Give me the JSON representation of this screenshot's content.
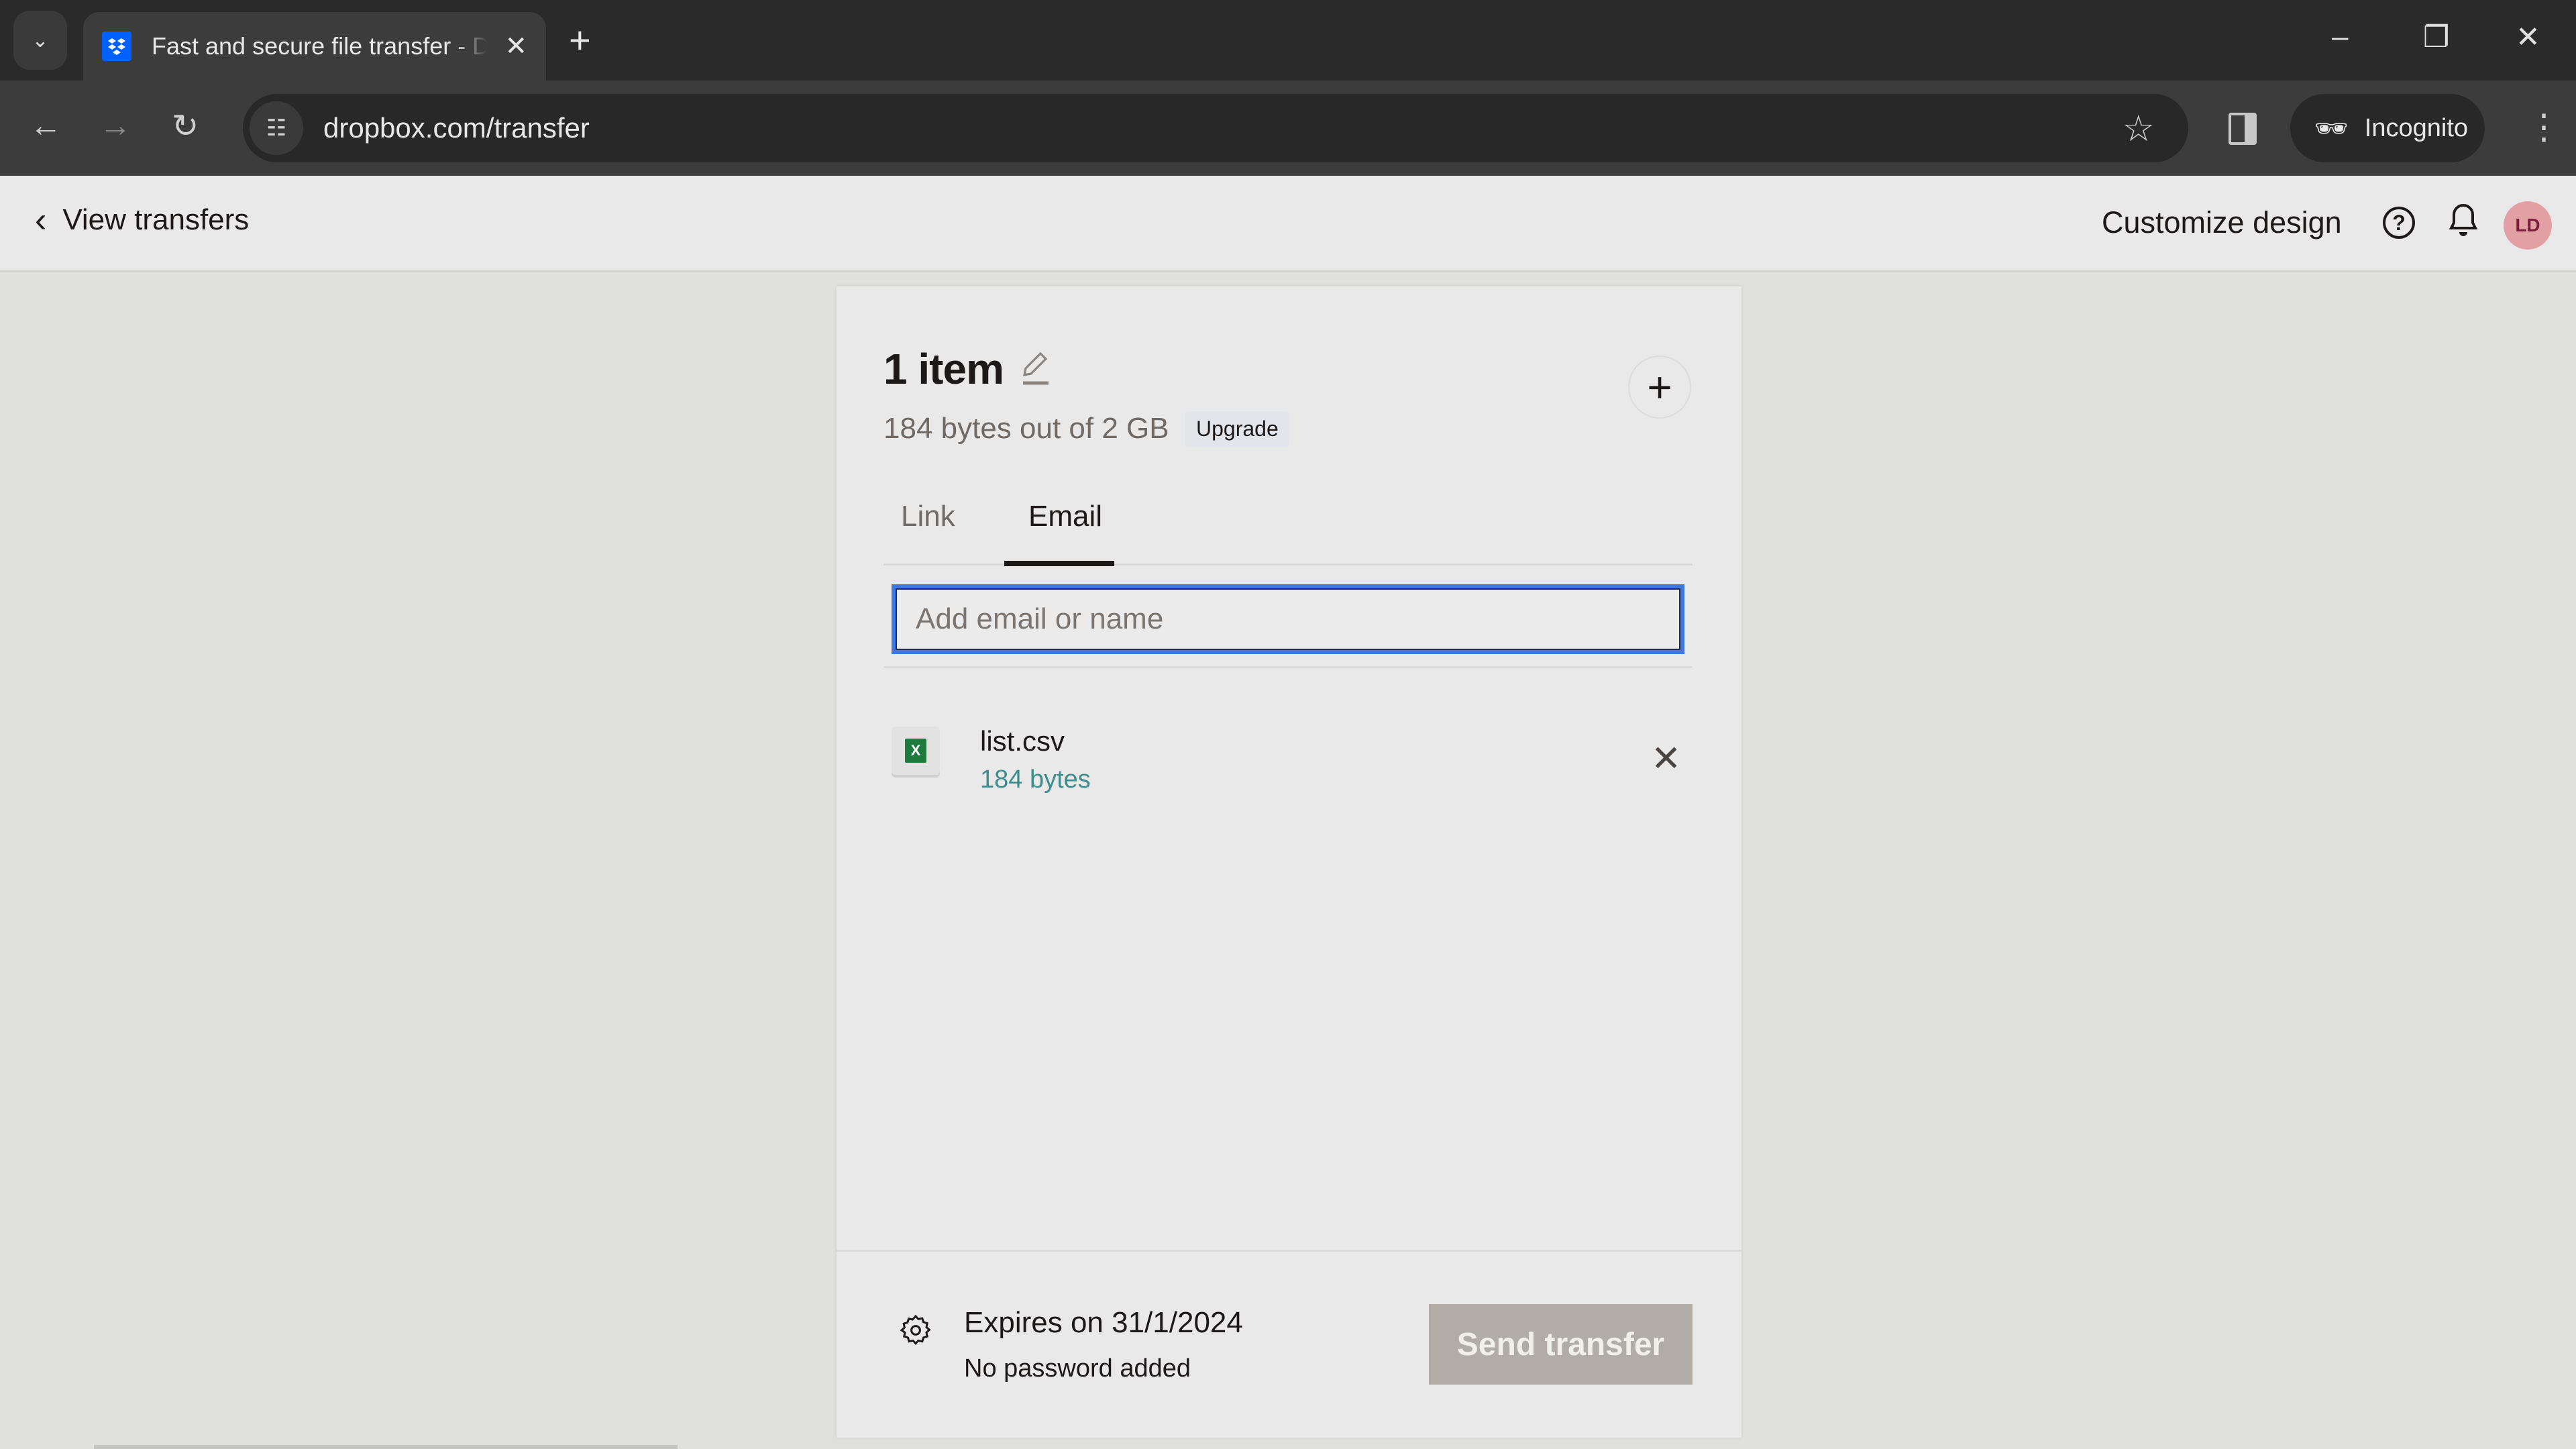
{
  "browser": {
    "tab_title": "Fast and secure file transfer - Dropbox",
    "url": "dropbox.com/transfer",
    "incognito_label": "Incognito",
    "icons": {
      "tab_search": "chevron-down-icon",
      "favicon": "dropbox-icon",
      "tab_close": "close-icon",
      "new_tab": "plus-icon",
      "back": "arrow-left-icon",
      "forward": "arrow-right-icon",
      "reload": "reload-icon",
      "site_info": "tune-icon",
      "bookmark": "star-icon",
      "side_panel": "side-panel-icon",
      "incognito": "incognito-icon",
      "menu": "kebab-menu-icon",
      "minimize": "minimize-icon",
      "restore": "restore-icon",
      "close_window": "close-icon"
    }
  },
  "header": {
    "back_label": "View transfers",
    "customize_label": "Customize design",
    "avatar_initials": "LD",
    "avatar_color": "#e3a0a4"
  },
  "transfer": {
    "title": "1 item",
    "usage_text": "184 bytes out of 2 GB",
    "upgrade_label": "Upgrade",
    "tabs": [
      {
        "label": "Link",
        "active": false
      },
      {
        "label": "Email",
        "active": true
      }
    ],
    "email_input": {
      "value": "",
      "placeholder": "Add email or name"
    },
    "files": [
      {
        "name": "list.csv",
        "size": "184 bytes",
        "type": "spreadsheet"
      }
    ],
    "expires_text": "Expires on 31/1/2024",
    "password_text": "No password added",
    "send_label": "Send transfer",
    "send_enabled": false
  },
  "colors": {
    "accent_focus": "#3f78e0",
    "file_size_text": "#3d8d8d",
    "send_disabled_bg": "#b1ada6",
    "dropbox_blue": "#0061fe"
  }
}
